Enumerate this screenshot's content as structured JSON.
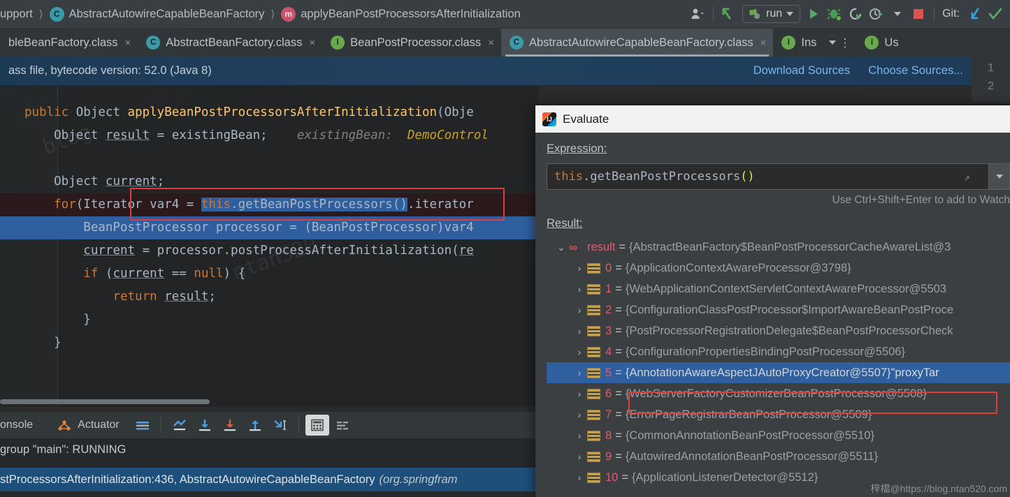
{
  "navbar": {
    "crumbs": [
      {
        "text": "upport",
        "icon": null
      },
      {
        "text": "AbstractAutowireCapableBeanFactory",
        "icon": "class-badge-icon"
      },
      {
        "text": "applyBeanPostProcessorsAfterInitialization",
        "icon": "method-badge-icon"
      }
    ],
    "run_config_label": "run",
    "git_label": "Git:",
    "icons": [
      "user-avatar-icon",
      "back-arrow-icon",
      "run-icon",
      "debug-icon",
      "rerun-icon",
      "profile-icon",
      "stop-icon",
      "git-update-icon",
      "git-commit-icon"
    ]
  },
  "tabs": [
    {
      "label": "bleBeanFactory.class",
      "icon": null,
      "active": false,
      "close": "×"
    },
    {
      "label": "AbstractBeanFactory.class",
      "icon": "class-badge-icon",
      "active": false,
      "close": "×"
    },
    {
      "label": "BeanPostProcessor.class",
      "icon": "interface-badge-icon",
      "active": false,
      "close": "×"
    },
    {
      "label": "AbstractAutowireCapableBeanFactory.class",
      "icon": "class-badge-icon",
      "active": true,
      "close": "×"
    },
    {
      "label": "Ins",
      "icon": "interface-badge-icon",
      "active": false,
      "close": null
    },
    {
      "label": "Us",
      "icon": "interface-badge-icon",
      "active": false,
      "close": null
    }
  ],
  "notification": {
    "message": "ass file, bytecode version: 52.0 (Java 8)",
    "links": [
      "Download Sources",
      "Choose Sources..."
    ]
  },
  "right_gutter": {
    "lines": [
      "1",
      "2"
    ]
  },
  "editor": {
    "lines": [
      {
        "tokens": [
          {
            "t": "public ",
            "c": "kw"
          },
          {
            "t": "Object ",
            "c": "typ"
          },
          {
            "t": "applyBeanPostProcessorsAfterInitialization",
            "c": "mname"
          },
          {
            "t": "(Obje",
            "c": "plain"
          }
        ]
      },
      {
        "tokens": [
          {
            "t": "    Object ",
            "c": "typ"
          },
          {
            "t": "result",
            "c": "var"
          },
          {
            "t": " = existingBean;    ",
            "c": "plain"
          },
          {
            "t": "existingBean:  ",
            "c": "hint"
          },
          {
            "t": "DemoControl",
            "c": "hintv"
          }
        ]
      },
      {
        "tokens": []
      },
      {
        "tokens": [
          {
            "t": "    Object ",
            "c": "typ"
          },
          {
            "t": "current",
            "c": "var"
          },
          {
            "t": ";",
            "c": "plain"
          }
        ]
      },
      {
        "tokens": [
          {
            "t": "    for",
            "c": "kw"
          },
          {
            "t": "(Iterator var4 = ",
            "c": "plain"
          },
          {
            "t": "this",
            "c": "kw"
          },
          {
            "t": ".getBeanPostProcessors().iterator",
            "c": "plain"
          }
        ],
        "style": "hl-current"
      },
      {
        "tokens": [
          {
            "t": "        BeanPostProcessor processor = (BeanPostProcessor)var4",
            "c": "plain"
          }
        ],
        "style": "hl-exec"
      },
      {
        "tokens": [
          {
            "t": "        ",
            "c": "plain"
          },
          {
            "t": "current",
            "c": "var"
          },
          {
            "t": " = processor.postProcessAfterInitialization(",
            "c": "plain"
          },
          {
            "t": "re",
            "c": "var"
          }
        ]
      },
      {
        "tokens": [
          {
            "t": "        if ",
            "c": "kw"
          },
          {
            "t": "(",
            "c": "plain"
          },
          {
            "t": "current",
            "c": "var"
          },
          {
            "t": " == ",
            "c": "plain"
          },
          {
            "t": "null",
            "c": "kw"
          },
          {
            "t": ") {",
            "c": "plain"
          }
        ]
      },
      {
        "tokens": [
          {
            "t": "            return ",
            "c": "kw"
          },
          {
            "t": "result",
            "c": "var"
          },
          {
            "t": ";",
            "c": "plain"
          }
        ]
      },
      {
        "tokens": [
          {
            "t": "        }",
            "c": "plain"
          }
        ]
      },
      {
        "tokens": [
          {
            "t": "    }",
            "c": "plain"
          }
        ]
      }
    ],
    "highlight_box_label": "applyBeanPostProcessorsAfterInitialization"
  },
  "debug_toolbar": {
    "console_label": "onsole",
    "actuator_label": "Actuator",
    "icons": [
      "actuator-icon",
      "layout-icon",
      "show-execution-point-icon",
      "step-over-icon",
      "step-into-icon",
      "step-out-icon",
      "run-to-cursor-icon",
      "evaluate-expression-icon",
      "settings-icon"
    ]
  },
  "console": {
    "thread_status": " group \"main\": RUNNING",
    "frame": "stProcessorsAfterInitialization:436, AbstractAutowireCapableBeanFactory",
    "frame_package": "(org.springfram"
  },
  "dialog": {
    "title": "Evaluate",
    "expression_label": "Expression:",
    "expression_value": "this.getBeanPostProcessors()",
    "expression_tokens": [
      {
        "t": "this",
        "c": "ex-this"
      },
      {
        "t": ".",
        "c": "ex-dot"
      },
      {
        "t": "getBeanPostProcessors",
        "c": "ex-meth"
      },
      {
        "t": "()",
        "c": "ex-paren"
      }
    ],
    "hint": "Use Ctrl+Shift+Enter to add to Watch",
    "result_label": "Result:",
    "tree": [
      {
        "indent": 0,
        "twisty": "⌄",
        "icon": "oo",
        "name": "result",
        "eq": "=",
        "value": "{AbstractBeanFactory$BeanPostProcessorCacheAwareList@3",
        "str": "",
        "selected": false
      },
      {
        "indent": 1,
        "twisty": "›",
        "icon": "arr",
        "name": "0",
        "eq": "=",
        "value": "{ApplicationContextAwareProcessor@3798}",
        "str": "",
        "selected": false
      },
      {
        "indent": 1,
        "twisty": "›",
        "icon": "arr",
        "name": "1",
        "eq": "=",
        "value": "{WebApplicationContextServletContextAwareProcessor@5503",
        "str": "",
        "selected": false
      },
      {
        "indent": 1,
        "twisty": "›",
        "icon": "arr",
        "name": "2",
        "eq": "=",
        "value": "{ConfigurationClassPostProcessor$ImportAwareBeanPostProce",
        "str": "",
        "selected": false
      },
      {
        "indent": 1,
        "twisty": "›",
        "icon": "arr",
        "name": "3",
        "eq": "=",
        "value": "{PostProcessorRegistrationDelegate$BeanPostProcessorCheck",
        "str": "",
        "selected": false
      },
      {
        "indent": 1,
        "twisty": "›",
        "icon": "arr",
        "name": "4",
        "eq": "=",
        "value": "{ConfigurationPropertiesBindingPostProcessor@5506}",
        "str": "",
        "selected": false
      },
      {
        "indent": 1,
        "twisty": "›",
        "icon": "arr",
        "name": "5",
        "eq": "=",
        "value": "{AnnotationAwareAspectJAutoProxyCreator@5507}",
        "str": " \"proxyTar",
        "selected": true
      },
      {
        "indent": 1,
        "twisty": "›",
        "icon": "arr",
        "name": "6",
        "eq": "=",
        "value": "{WebServerFactoryCustomizerBeanPostProcessor@5508}",
        "str": "",
        "selected": false
      },
      {
        "indent": 1,
        "twisty": "›",
        "icon": "arr",
        "name": "7",
        "eq": "=",
        "value": "{ErrorPageRegistrarBeanPostProcessor@5509}",
        "str": "",
        "selected": false
      },
      {
        "indent": 1,
        "twisty": "›",
        "icon": "arr",
        "name": "8",
        "eq": "=",
        "value": "{CommonAnnotationBeanPostProcessor@5510}",
        "str": "",
        "selected": false
      },
      {
        "indent": 1,
        "twisty": "›",
        "icon": "arr",
        "name": "9",
        "eq": "=",
        "value": "{AutowiredAnnotationBeanPostProcessor@5511}",
        "str": "",
        "selected": false
      },
      {
        "indent": 1,
        "twisty": "›",
        "icon": "arr",
        "name": "10",
        "eq": "=",
        "value": "{ApplicationListenerDetector@5512}",
        "str": "",
        "selected": false
      }
    ]
  },
  "watermark": "梓檔@https://blog.ntan520.com",
  "colors": {
    "accent_blue": "#2f5f9e",
    "highlight_red": "#e33b3b",
    "link_blue": "#78b6ef",
    "keyword_orange": "#cc7832",
    "method_yellow": "#ffc66d"
  }
}
